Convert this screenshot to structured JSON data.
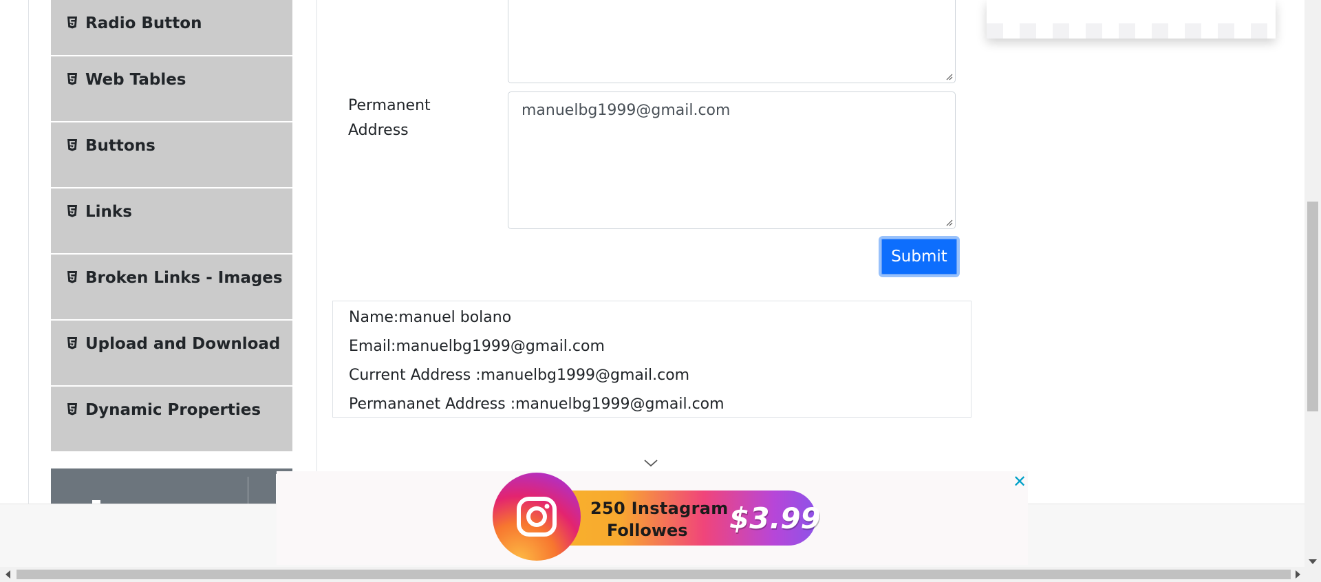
{
  "sidebar": {
    "items": [
      {
        "label": "Radio Button",
        "icon": "html5-icon"
      },
      {
        "label": "Web Tables",
        "icon": "html5-icon"
      },
      {
        "label": "Buttons",
        "icon": "html5-icon"
      },
      {
        "label": "Links",
        "icon": "html5-icon"
      },
      {
        "label": "Broken Links - Images",
        "icon": "html5-icon"
      },
      {
        "label": "Upload and Download",
        "icon": "html5-icon"
      },
      {
        "label": "Dynamic Properties",
        "icon": "html5-icon"
      }
    ]
  },
  "form": {
    "current_address_value": "",
    "permanent_address_label": "Permanent Address",
    "permanent_address_value": "manuelbg1999@gmail.com",
    "submit_label": "Submit"
  },
  "output": {
    "name": "Name:manuel bolano",
    "email": "Email:manuelbg1999@gmail.com",
    "current_address": "Current Address :manuelbg1999@gmail.com",
    "permanent_address": "Permananet Address :manuelbg1999@gmail.com"
  },
  "ad": {
    "line1": "250 Instagram",
    "line2": "Followes",
    "price": "$3.99",
    "close": "✕"
  },
  "colors": {
    "sidebar_bg": "#cbcbcb",
    "group_bg": "#6c757d",
    "submit_bg": "#0d6efd",
    "close_color": "#00a0c8"
  }
}
